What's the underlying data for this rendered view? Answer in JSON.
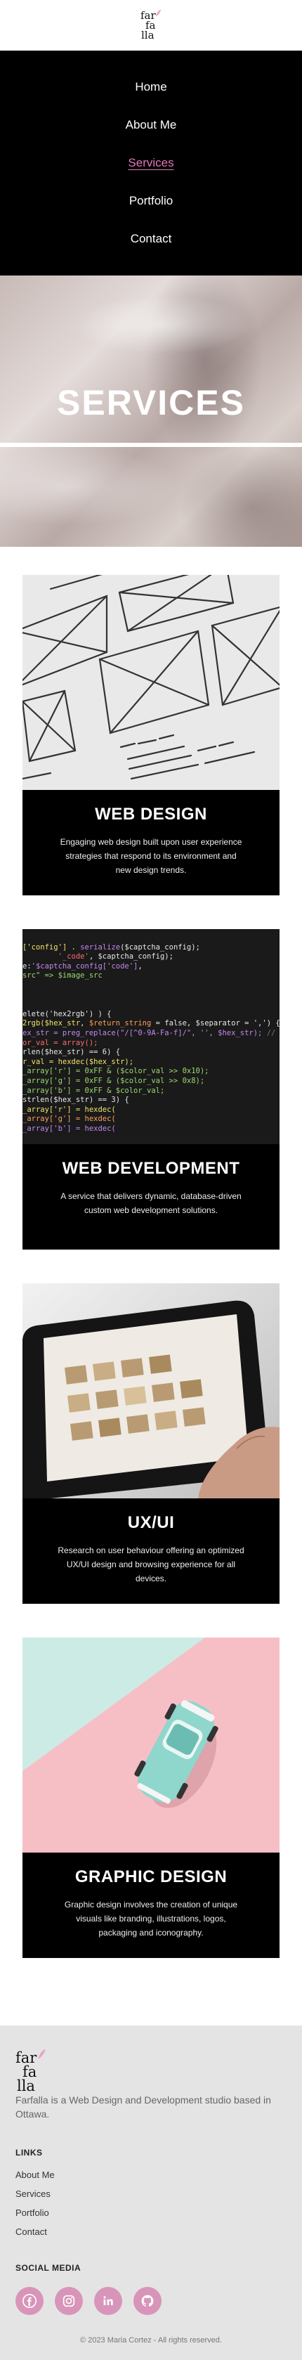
{
  "brand": {
    "logo_line1": "far",
    "logo_line2": "fa",
    "logo_line3": "lla",
    "accent_color": "#e377b7"
  },
  "nav": {
    "items": [
      {
        "label": "Home"
      },
      {
        "label": "About Me"
      },
      {
        "label": "Services",
        "active": true
      },
      {
        "label": "Portfolio"
      },
      {
        "label": "Contact"
      }
    ]
  },
  "hero": {
    "title": "SERVICES"
  },
  "services": [
    {
      "title": "WEB DESIGN",
      "description": "Engaging web design built upon user experience strategies that respond to its environment and new design trends.",
      "image_icon": "wireframe-sketch-image"
    },
    {
      "title": "WEB DEVELOPMENT",
      "description": "A service that delivers dynamic, database-driven custom web development solutions.",
      "image_icon": "code-editor-image"
    },
    {
      "title": "UX/UI",
      "description": "Research on user behaviour offering an optimized UX/UI design and browsing experience for all devices.",
      "image_icon": "tablet-layout-image"
    },
    {
      "title": "GRAPHIC DESIGN",
      "description": "Graphic design involves the creation of unique visuals like branding, illustrations, logos, packaging and iconography.",
      "image_icon": "toy-car-image"
    }
  ],
  "footer": {
    "about": "Farfalla is a Web Design and Development studio based in Ottawa.",
    "links_heading": "LINKS",
    "links": [
      "About Me",
      "Services",
      "Portfolio",
      "Contact"
    ],
    "social_heading": "SOCIAL MEDIA",
    "social_icons": [
      "facebook-icon",
      "instagram-icon",
      "linkedin-icon",
      "github-icon"
    ],
    "social_color": "#d895b9",
    "copyright": "© 2023 Maria Cortez - All rights reserved."
  }
}
